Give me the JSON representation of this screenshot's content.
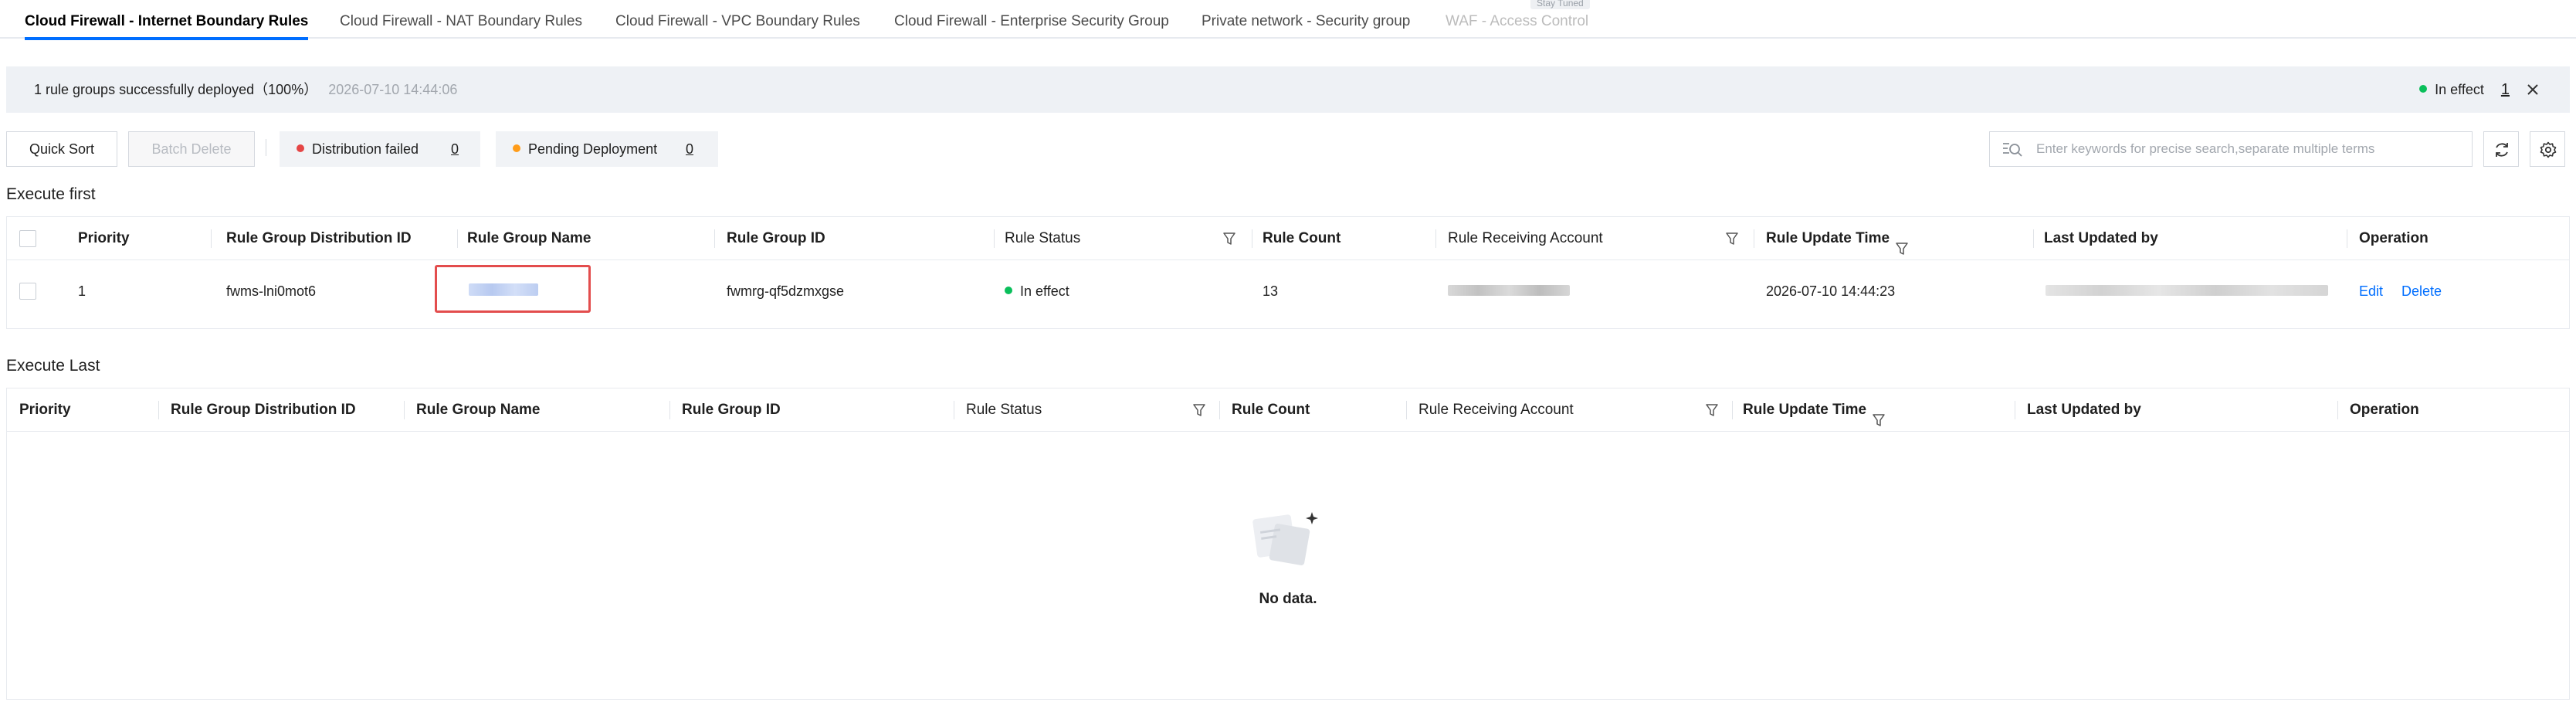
{
  "tabs": [
    {
      "label": "Cloud Firewall - Internet Boundary Rules",
      "active": true
    },
    {
      "label": "Cloud Firewall - NAT Boundary Rules"
    },
    {
      "label": "Cloud Firewall - VPC Boundary Rules"
    },
    {
      "label": "Cloud Firewall - Enterprise Security Group"
    },
    {
      "label": "Private network - Security group"
    },
    {
      "label": "WAF - Access Control",
      "disabled": true,
      "badge": "Stay Tuned"
    }
  ],
  "banner": {
    "message": "1 rule groups successfully deployed（100%）",
    "time": "2026-07-10 14:44:06",
    "status_label": "In effect",
    "status_count": "1"
  },
  "toolbar": {
    "quick_sort": "Quick Sort",
    "batch_delete": "Batch Delete",
    "distribution_failed": {
      "label": "Distribution failed",
      "count": "0"
    },
    "pending_deployment": {
      "label": "Pending Deployment",
      "count": "0"
    },
    "search_placeholder": "Enter keywords for precise search,separate multiple terms"
  },
  "columns": {
    "priority": "Priority",
    "distribution_id": "Rule Group Distribution ID",
    "group_name": "Rule Group Name",
    "group_id": "Rule Group ID",
    "status": "Rule Status",
    "count": "Rule Count",
    "receiving_account": "Rule Receiving Account",
    "update_time": "Rule Update Time",
    "updated_by": "Last Updated by",
    "operation": "Operation"
  },
  "execute_first": {
    "title": "Execute first",
    "rows": [
      {
        "priority": "1",
        "distribution_id": "fwms-lni0mot6",
        "group_id": "fwmrg-qf5dzmxgse",
        "status": "In effect",
        "count": "13",
        "update_time": "2026-07-10 14:44:23",
        "edit": "Edit",
        "delete": "Delete"
      }
    ]
  },
  "execute_last": {
    "title": "Execute Last",
    "empty_text": "No data."
  },
  "colors": {
    "accent": "#006eff",
    "success": "#0abf5b",
    "error": "#e54545",
    "warning": "#ff9c19",
    "highlight_border": "#e34d4d"
  }
}
